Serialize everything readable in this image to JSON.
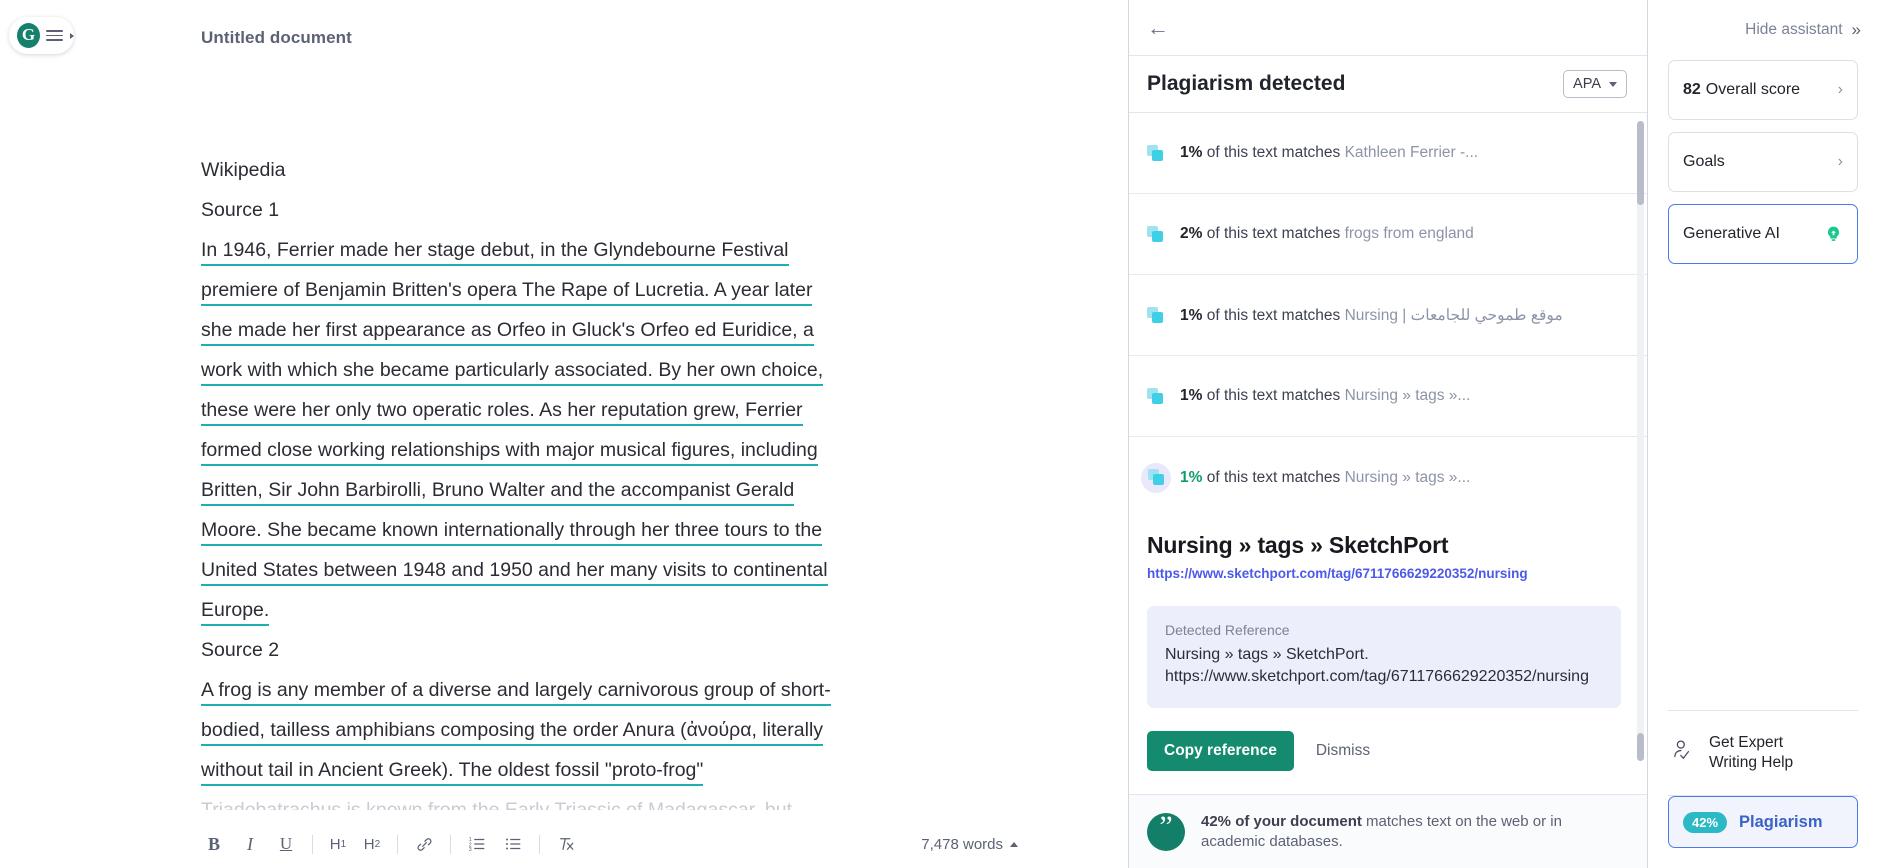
{
  "editor": {
    "logo_icon": "grammarly-g-icon",
    "menu_icon": "hamburger-menu-icon",
    "doc_title": "Untitled document",
    "help_icon": "?",
    "lines": [
      {
        "text": "Wikipedia",
        "flagged": false
      },
      {
        "text": "Source 1",
        "flagged": false
      },
      {
        "text": "In 1946, Ferrier made her stage debut, in the Glyndebourne Festival",
        "flagged": true
      },
      {
        "text": "premiere of Benjamin Britten's opera The Rape of Lucretia. A year later",
        "flagged": true
      },
      {
        "text": "she made her first appearance as Orfeo in Gluck's Orfeo ed Euridice, a",
        "flagged": true
      },
      {
        "text": "work with which she became particularly associated. By her own choice,",
        "flagged": true
      },
      {
        "text": "these were her only two operatic roles. As her reputation grew, Ferrier",
        "flagged": true
      },
      {
        "text": "formed close working relationships with major musical figures, including",
        "flagged": true
      },
      {
        "text": "Britten, Sir John Barbirolli, Bruno Walter and the accompanist Gerald",
        "flagged": true
      },
      {
        "text": "Moore. She became known internationally through her three tours to the",
        "flagged": true
      },
      {
        "text": "United States between 1948 and 1950 and her many visits to continental",
        "flagged": true
      },
      {
        "text": "Europe.",
        "flagged": true
      },
      {
        "text": "Source 2",
        "flagged": false
      },
      {
        "text": "A frog is any member of a diverse and largely carnivorous group of short-",
        "flagged": true
      },
      {
        "text": "bodied, tailless amphibians composing the order Anura (ἀνούρα, literally",
        "flagged": true
      },
      {
        "text": "without tail in Ancient Greek). The oldest fossil \"proto-frog\"",
        "flagged": true
      },
      {
        "text": "Triadobatrachus is known from the Early Triassic of Madagascar, but",
        "flagged": false
      }
    ],
    "toolbar": {
      "bold": "B",
      "italic": "I",
      "underline": "U",
      "h1": "H",
      "h1_sub": "1",
      "h2": "H",
      "h2_sub": "2",
      "link_icon": "link-icon",
      "ordered_list_icon": "ordered-list-icon",
      "bullet_list_icon": "bullet-list-icon",
      "clear_format_icon": "clear-formatting-icon",
      "word_count": "7,478 words"
    }
  },
  "plagiarism": {
    "back_icon": "back-arrow-icon",
    "heading": "Plagiarism detected",
    "style_selector": "APA",
    "matches": [
      {
        "pct": "1%",
        "middle": " of this text matches ",
        "source": "Kathleen Ferrier -...",
        "active": false,
        "rtl": false
      },
      {
        "pct": "2%",
        "middle": " of this text matches ",
        "source": "frogs from england",
        "active": false,
        "rtl": false
      },
      {
        "pct": "1%",
        "middle": " of this text matches ",
        "source": "Nursing | موقع طموحي للجامعات",
        "active": false,
        "rtl": false
      },
      {
        "pct": "1%",
        "middle": " of this text matches ",
        "source": "Nursing » tags »...",
        "active": false,
        "rtl": false
      },
      {
        "pct": "1%",
        "middle": " of this text matches ",
        "source": "Nursing » tags »...",
        "active": true,
        "rtl": false
      }
    ],
    "detail": {
      "title": "Nursing » tags » SketchPort",
      "url": "https://www.sketchport.com/tag/6711766629220352/nursing",
      "ref_label": "Detected Reference",
      "ref_text": "Nursing » tags » SketchPort. https://www.sketchport.com/tag/6711766629220352/nursing",
      "copy_label": "Copy reference",
      "dismiss_label": "Dismiss"
    },
    "footer": {
      "quote_icon": "quote-icon",
      "strong": "42% of your document",
      "rest": " matches text on the web or in academic databases."
    }
  },
  "assistant": {
    "hide_label": "Hide assistant",
    "hide_icon": "chevron-double-right-icon",
    "score_value": "82",
    "score_label": "Overall score",
    "goals_label": "Goals",
    "genai_label": "Generative AI",
    "genai_icon": "lightbulb-icon",
    "expert_icon": "person-check-icon",
    "expert_label_line1": "Get Expert",
    "expert_label_line2": "Writing Help",
    "plagiarism_pct": "42%",
    "plagiarism_label": "Plagiarism"
  },
  "colors": {
    "brand_green": "#15806b",
    "accent_teal": "#1eb0b0",
    "link_blue": "#4c5ae8",
    "chip_blue": "#3a62c8",
    "chip_teal": "#2cb9c6"
  }
}
